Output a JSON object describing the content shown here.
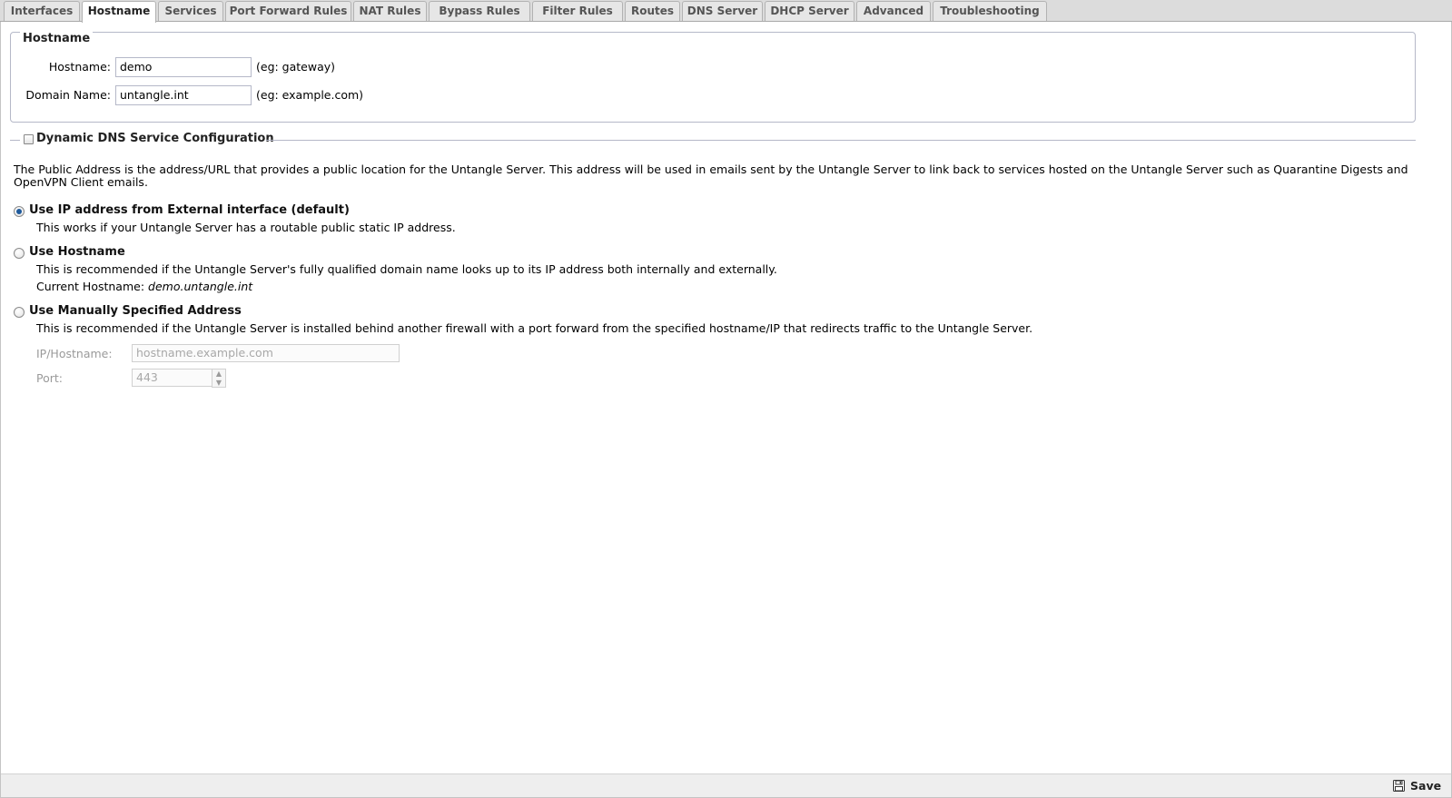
{
  "tabs": [
    "Interfaces",
    "Hostname",
    "Services",
    "Port Forward Rules",
    "NAT Rules",
    "Bypass Rules",
    "Filter Rules",
    "Routes",
    "DNS Server",
    "DHCP Server",
    "Advanced",
    "Troubleshooting"
  ],
  "active_tab": "Hostname",
  "hostname_section": {
    "legend": "Hostname",
    "hostname_label": "Hostname:",
    "hostname_value": "demo",
    "hostname_hint": "(eg: gateway)",
    "domain_label": "Domain Name:",
    "domain_value": "untangle.int",
    "domain_hint": "(eg: example.com)"
  },
  "ddns": {
    "legend": "Dynamic DNS Service Configuration",
    "checked": false
  },
  "public_address": {
    "description": "The Public Address is the address/URL that provides a public location for the Untangle Server. This address will be used in emails sent by the Untangle Server to link back to services hosted on the Untangle Server such as Quarantine Digests and OpenVPN Client emails.",
    "option_external": {
      "label": "Use IP address from External interface (default)",
      "help": "This works if your Untangle Server has a routable public static IP address.",
      "selected": true
    },
    "option_hostname": {
      "label": "Use Hostname",
      "help": "This is recommended if the Untangle Server's fully qualified domain name looks up to its IP address both internally and externally.",
      "current_label": "Current Hostname:",
      "current_value": "demo.untangle.int",
      "selected": false
    },
    "option_manual": {
      "label": "Use Manually Specified Address",
      "help": "This is recommended if the Untangle Server is installed behind another firewall with a port forward from the specified hostname/IP that redirects traffic to the Untangle Server.",
      "ip_label": "IP/Hostname:",
      "ip_placeholder": "hostname.example.com",
      "port_label": "Port:",
      "port_value": "443",
      "selected": false
    }
  },
  "footer": {
    "save_label": "Save"
  }
}
